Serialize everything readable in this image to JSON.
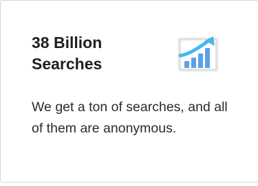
{
  "card": {
    "title": "38 Billion Searches",
    "description": "We get a ton of searches, and all of them are anonymous.",
    "icon": "growth-chart-icon"
  },
  "colors": {
    "icon_frame": "#e3e3e3",
    "icon_bar": "#5aa2e8",
    "icon_arrow": "#43b7f0"
  }
}
